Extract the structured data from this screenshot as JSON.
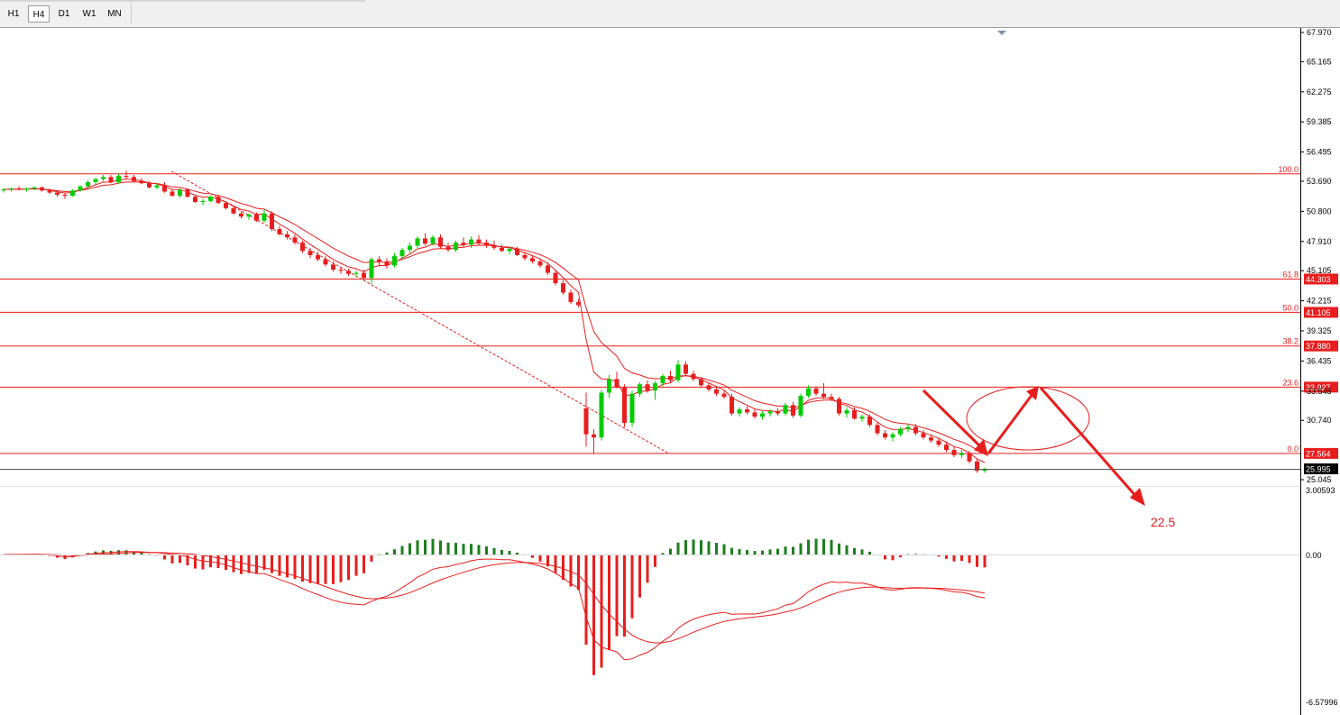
{
  "toolbar": {
    "timeframes": [
      "H1",
      "H4",
      "D1",
      "W1",
      "MN"
    ],
    "active": "H4"
  },
  "colors": {
    "bull": "#00cc00",
    "bear": "#e81e1e",
    "ma": "#e81e1e",
    "macd_pos": "#1e7e1e",
    "macd_neg": "#e81e1e",
    "fib": "#e81e1e",
    "price_line": "#555555"
  },
  "price_axis": {
    "ticks": [
      "67.970",
      "65.165",
      "62.275",
      "59.385",
      "56.495",
      "53.690",
      "50.800",
      "47.910",
      "45.105",
      "42.215",
      "39.325",
      "36.435",
      "33.545",
      "30.740",
      "25.045"
    ],
    "current_price": "25.995"
  },
  "fib_levels": [
    {
      "label": "100.0",
      "value": "54.4",
      "tag": ""
    },
    {
      "label": "61.8",
      "value": "44.303",
      "tag": "44.303"
    },
    {
      "label": "50.0",
      "value": "41.105",
      "tag": "41.105"
    },
    {
      "label": "38.2",
      "value": "37.880",
      "tag": "37.880"
    },
    {
      "label": "23.6",
      "value": "33.927",
      "tag": "33.927"
    },
    {
      "label": "0.0",
      "value": "27.564",
      "tag": "27.564"
    }
  ],
  "macd_axis": {
    "top": "3.00593",
    "zero": "0.00",
    "bottom": "-6.57996"
  },
  "annotation": {
    "target": "22.5"
  },
  "chart_data": {
    "type": "candlestick",
    "timeframe": "H4",
    "ohlc": [
      [
        52.8,
        53.0,
        52.6,
        52.9
      ],
      [
        52.9,
        53.1,
        52.7,
        53.0
      ],
      [
        53.0,
        53.2,
        52.8,
        52.9
      ],
      [
        52.9,
        53.1,
        52.7,
        53.0
      ],
      [
        53.0,
        53.2,
        52.8,
        53.1
      ],
      [
        53.1,
        53.2,
        52.7,
        52.8
      ],
      [
        52.8,
        53.0,
        52.5,
        52.6
      ],
      [
        52.6,
        52.8,
        52.2,
        52.4
      ],
      [
        52.4,
        52.6,
        52.0,
        52.3
      ],
      [
        52.3,
        52.9,
        52.2,
        52.8
      ],
      [
        52.8,
        53.3,
        52.7,
        53.2
      ],
      [
        53.2,
        53.8,
        53.0,
        53.6
      ],
      [
        53.6,
        54.0,
        53.4,
        53.9
      ],
      [
        53.9,
        54.3,
        53.7,
        54.1
      ],
      [
        54.1,
        54.3,
        53.5,
        53.6
      ],
      [
        53.6,
        54.4,
        53.5,
        54.2
      ],
      [
        54.2,
        54.7,
        53.9,
        54.1
      ],
      [
        54.1,
        54.3,
        53.6,
        53.7
      ],
      [
        53.7,
        54.0,
        53.4,
        53.5
      ],
      [
        53.5,
        53.7,
        53.0,
        53.1
      ],
      [
        53.1,
        53.5,
        52.9,
        53.3
      ],
      [
        53.3,
        53.6,
        52.6,
        52.7
      ],
      [
        52.7,
        52.9,
        52.2,
        52.3
      ],
      [
        52.3,
        53.0,
        52.1,
        52.9
      ],
      [
        52.9,
        53.0,
        52.1,
        52.2
      ],
      [
        52.2,
        52.4,
        51.6,
        51.7
      ],
      [
        51.7,
        52.0,
        51.4,
        51.8
      ],
      [
        51.8,
        52.3,
        51.7,
        52.2
      ],
      [
        52.2,
        52.4,
        51.5,
        51.6
      ],
      [
        51.6,
        51.8,
        51.0,
        51.1
      ],
      [
        51.1,
        51.3,
        50.5,
        50.6
      ],
      [
        50.6,
        50.8,
        50.1,
        50.3
      ],
      [
        50.3,
        50.6,
        50.0,
        50.5
      ],
      [
        50.5,
        50.7,
        49.8,
        49.9
      ],
      [
        49.9,
        51.0,
        49.7,
        50.6
      ],
      [
        50.6,
        50.8,
        48.9,
        49.1
      ],
      [
        49.1,
        49.4,
        48.5,
        48.6
      ],
      [
        48.6,
        48.9,
        48.1,
        48.3
      ],
      [
        48.3,
        48.6,
        47.6,
        47.8
      ],
      [
        47.8,
        48.0,
        46.8,
        47.0
      ],
      [
        47.0,
        47.3,
        46.3,
        46.6
      ],
      [
        46.6,
        46.9,
        46.0,
        46.2
      ],
      [
        46.2,
        46.5,
        45.5,
        45.7
      ],
      [
        45.7,
        46.0,
        45.0,
        45.2
      ],
      [
        45.2,
        45.5,
        44.8,
        45.1
      ],
      [
        45.1,
        45.3,
        44.6,
        44.8
      ],
      [
        44.8,
        45.1,
        44.5,
        44.9
      ],
      [
        44.9,
        45.2,
        44.2,
        44.4
      ],
      [
        44.4,
        46.4,
        43.8,
        46.2
      ],
      [
        46.2,
        46.5,
        45.6,
        46.0
      ],
      [
        46.0,
        46.3,
        45.3,
        45.6
      ],
      [
        45.6,
        46.8,
        45.4,
        46.5
      ],
      [
        46.5,
        47.3,
        46.2,
        47.1
      ],
      [
        47.1,
        47.8,
        46.8,
        47.5
      ],
      [
        47.5,
        48.4,
        47.3,
        48.2
      ],
      [
        48.2,
        48.7,
        47.5,
        47.7
      ],
      [
        47.7,
        48.5,
        47.5,
        48.3
      ],
      [
        48.3,
        48.6,
        47.2,
        47.4
      ],
      [
        47.4,
        47.8,
        46.9,
        47.1
      ],
      [
        47.1,
        48.0,
        46.9,
        47.8
      ],
      [
        47.8,
        48.3,
        47.4,
        47.6
      ],
      [
        47.6,
        48.4,
        47.3,
        48.1
      ],
      [
        48.1,
        48.5,
        47.6,
        47.8
      ],
      [
        47.8,
        48.1,
        47.3,
        47.5
      ],
      [
        47.5,
        48.0,
        47.1,
        47.3
      ],
      [
        47.3,
        47.6,
        46.9,
        47.0
      ],
      [
        47.0,
        47.4,
        46.7,
        47.2
      ],
      [
        47.2,
        47.4,
        46.5,
        46.6
      ],
      [
        46.6,
        46.9,
        46.1,
        46.3
      ],
      [
        46.3,
        46.6,
        45.8,
        46.0
      ],
      [
        46.0,
        46.3,
        45.4,
        45.6
      ],
      [
        45.6,
        45.9,
        44.7,
        44.9
      ],
      [
        44.9,
        45.2,
        43.7,
        43.9
      ],
      [
        43.9,
        44.2,
        42.8,
        43.0
      ],
      [
        43.0,
        43.3,
        41.9,
        42.1
      ],
      [
        42.1,
        42.4,
        41.6,
        41.8
      ],
      [
        31.9,
        33.4,
        28.2,
        29.4
      ],
      [
        29.4,
        29.9,
        27.5,
        29.1
      ],
      [
        29.1,
        33.7,
        28.8,
        33.4
      ],
      [
        33.4,
        35.1,
        32.9,
        34.7
      ],
      [
        34.7,
        35.4,
        33.8,
        33.9
      ],
      [
        33.9,
        34.2,
        30.1,
        30.5
      ],
      [
        30.5,
        33.6,
        30.1,
        33.3
      ],
      [
        33.3,
        34.4,
        33.0,
        34.2
      ],
      [
        34.2,
        34.6,
        33.4,
        33.6
      ],
      [
        33.6,
        34.5,
        32.7,
        34.3
      ],
      [
        34.3,
        35.2,
        34.0,
        35.0
      ],
      [
        35.0,
        35.5,
        34.3,
        34.6
      ],
      [
        34.6,
        36.5,
        34.4,
        36.1
      ],
      [
        36.1,
        36.4,
        35.0,
        35.2
      ],
      [
        35.2,
        35.5,
        34.5,
        34.7
      ],
      [
        34.7,
        34.9,
        33.9,
        34.1
      ],
      [
        34.1,
        34.4,
        33.5,
        33.7
      ],
      [
        33.7,
        34.0,
        33.1,
        33.3
      ],
      [
        33.3,
        33.6,
        32.8,
        33.0
      ],
      [
        33.0,
        33.3,
        31.2,
        31.4
      ],
      [
        31.4,
        32.0,
        31.1,
        31.8
      ],
      [
        31.8,
        32.1,
        31.3,
        31.5
      ],
      [
        31.5,
        31.8,
        30.9,
        31.1
      ],
      [
        31.1,
        31.6,
        30.8,
        31.4
      ],
      [
        31.4,
        31.8,
        31.1,
        31.6
      ],
      [
        31.6,
        31.9,
        31.2,
        31.4
      ],
      [
        31.4,
        32.4,
        31.2,
        32.2
      ],
      [
        32.2,
        32.5,
        31.0,
        31.2
      ],
      [
        31.2,
        33.3,
        31.0,
        33.1
      ],
      [
        33.1,
        34.1,
        32.9,
        33.8
      ],
      [
        33.8,
        34.0,
        33.1,
        33.3
      ],
      [
        33.3,
        34.3,
        32.8,
        33.0
      ],
      [
        33.0,
        33.3,
        32.6,
        32.8
      ],
      [
        32.8,
        33.0,
        31.2,
        31.4
      ],
      [
        31.4,
        32.0,
        31.0,
        31.7
      ],
      [
        31.7,
        32.0,
        30.8,
        30.9
      ],
      [
        30.9,
        31.3,
        30.6,
        31.1
      ],
      [
        31.1,
        31.3,
        30.1,
        30.3
      ],
      [
        30.3,
        30.6,
        29.3,
        29.5
      ],
      [
        29.5,
        29.8,
        28.9,
        29.1
      ],
      [
        29.1,
        29.6,
        28.7,
        29.4
      ],
      [
        29.4,
        30.1,
        29.2,
        29.9
      ],
      [
        29.9,
        30.4,
        29.6,
        30.1
      ],
      [
        30.1,
        30.4,
        29.3,
        29.5
      ],
      [
        29.5,
        29.8,
        28.9,
        29.1
      ],
      [
        29.1,
        29.4,
        28.6,
        28.8
      ],
      [
        28.8,
        29.1,
        28.2,
        28.4
      ],
      [
        28.4,
        28.7,
        27.7,
        27.9
      ],
      [
        27.9,
        28.2,
        27.2,
        27.4
      ],
      [
        27.4,
        27.9,
        27.1,
        27.6
      ],
      [
        27.6,
        27.8,
        26.6,
        26.8
      ],
      [
        26.8,
        27.0,
        25.7,
        25.9
      ],
      [
        25.9,
        26.2,
        25.7,
        25.995
      ]
    ]
  }
}
